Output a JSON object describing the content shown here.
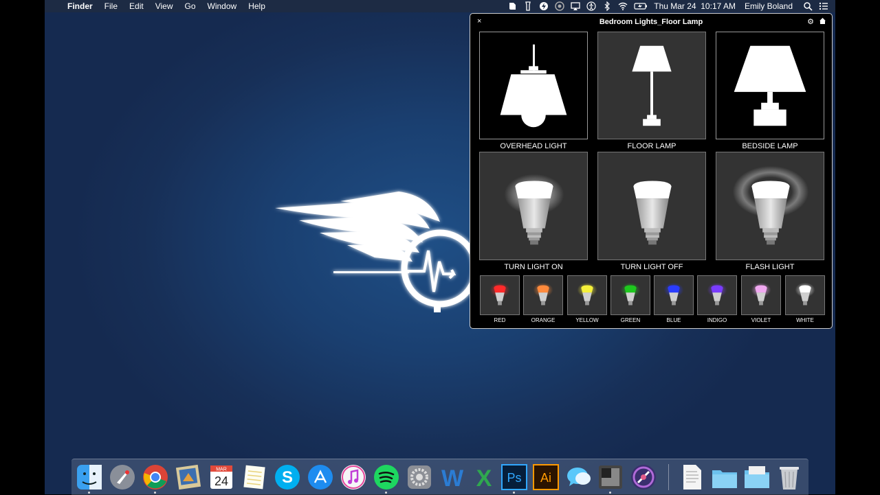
{
  "menubar": {
    "apple_glyph": "",
    "app_name": "Finder",
    "menus": [
      "File",
      "Edit",
      "View",
      "Go",
      "Window",
      "Help"
    ],
    "clock": "Thu Mar 24  10:17 AM",
    "user": "Emily Boland",
    "status_icons": [
      "evernote-icon",
      "flashlight-icon",
      "bolt-icon",
      "cloud-icon",
      "airplay-icon",
      "accessibility-icon",
      "bluetooth-icon",
      "wifi-icon",
      "battery-icon"
    ]
  },
  "panel": {
    "title": "Bedroom Lights_Floor Lamp",
    "close_glyph": "×",
    "gear_glyph": "⚙",
    "scenes": [
      {
        "label": "OVERHEAD LIGHT",
        "icon": "overhead-lamp-icon"
      },
      {
        "label": "FLOOR LAMP",
        "icon": "floor-lamp-icon"
      },
      {
        "label": "BEDSIDE LAMP",
        "icon": "bedside-lamp-icon"
      }
    ],
    "actions": [
      {
        "label": "TURN LIGHT ON",
        "icon": "bulb-glow-icon"
      },
      {
        "label": "TURN LIGHT OFF",
        "icon": "bulb-off-icon"
      },
      {
        "label": "FLASH LIGHT",
        "icon": "bulb-flash-icon"
      }
    ],
    "colors": [
      {
        "label": "RED",
        "hex": "#ff2a2a"
      },
      {
        "label": "ORANGE",
        "hex": "#ff8a3c"
      },
      {
        "label": "YELLOW",
        "hex": "#f5f03a"
      },
      {
        "label": "GREEN",
        "hex": "#1ec81e"
      },
      {
        "label": "BLUE",
        "hex": "#2a3cff"
      },
      {
        "label": "INDIGO",
        "hex": "#7a3cff"
      },
      {
        "label": "VIOLET",
        "hex": "#f0a8f0"
      },
      {
        "label": "WHITE",
        "hex": "#ffffff"
      }
    ]
  },
  "dock": {
    "calendar_month": "MAR",
    "calendar_day": "24",
    "ps_label": "Ps",
    "ai_label": "Ai",
    "word_label": "W",
    "excel_label": "X",
    "items": [
      "finder-icon",
      "launchpad-icon",
      "chrome-icon",
      "preview-icon",
      "calendar-icon",
      "notes-icon",
      "skype-icon",
      "app-store-icon",
      "itunes-icon",
      "spotify-icon",
      "system-preferences-icon",
      "word-icon",
      "excel-icon",
      "photoshop-icon",
      "illustrator-icon",
      "messages-icon",
      "stickies-icon",
      "imovie-icon",
      "document-icon",
      "folder-icon",
      "folder-icon-2",
      "trash-icon"
    ]
  }
}
